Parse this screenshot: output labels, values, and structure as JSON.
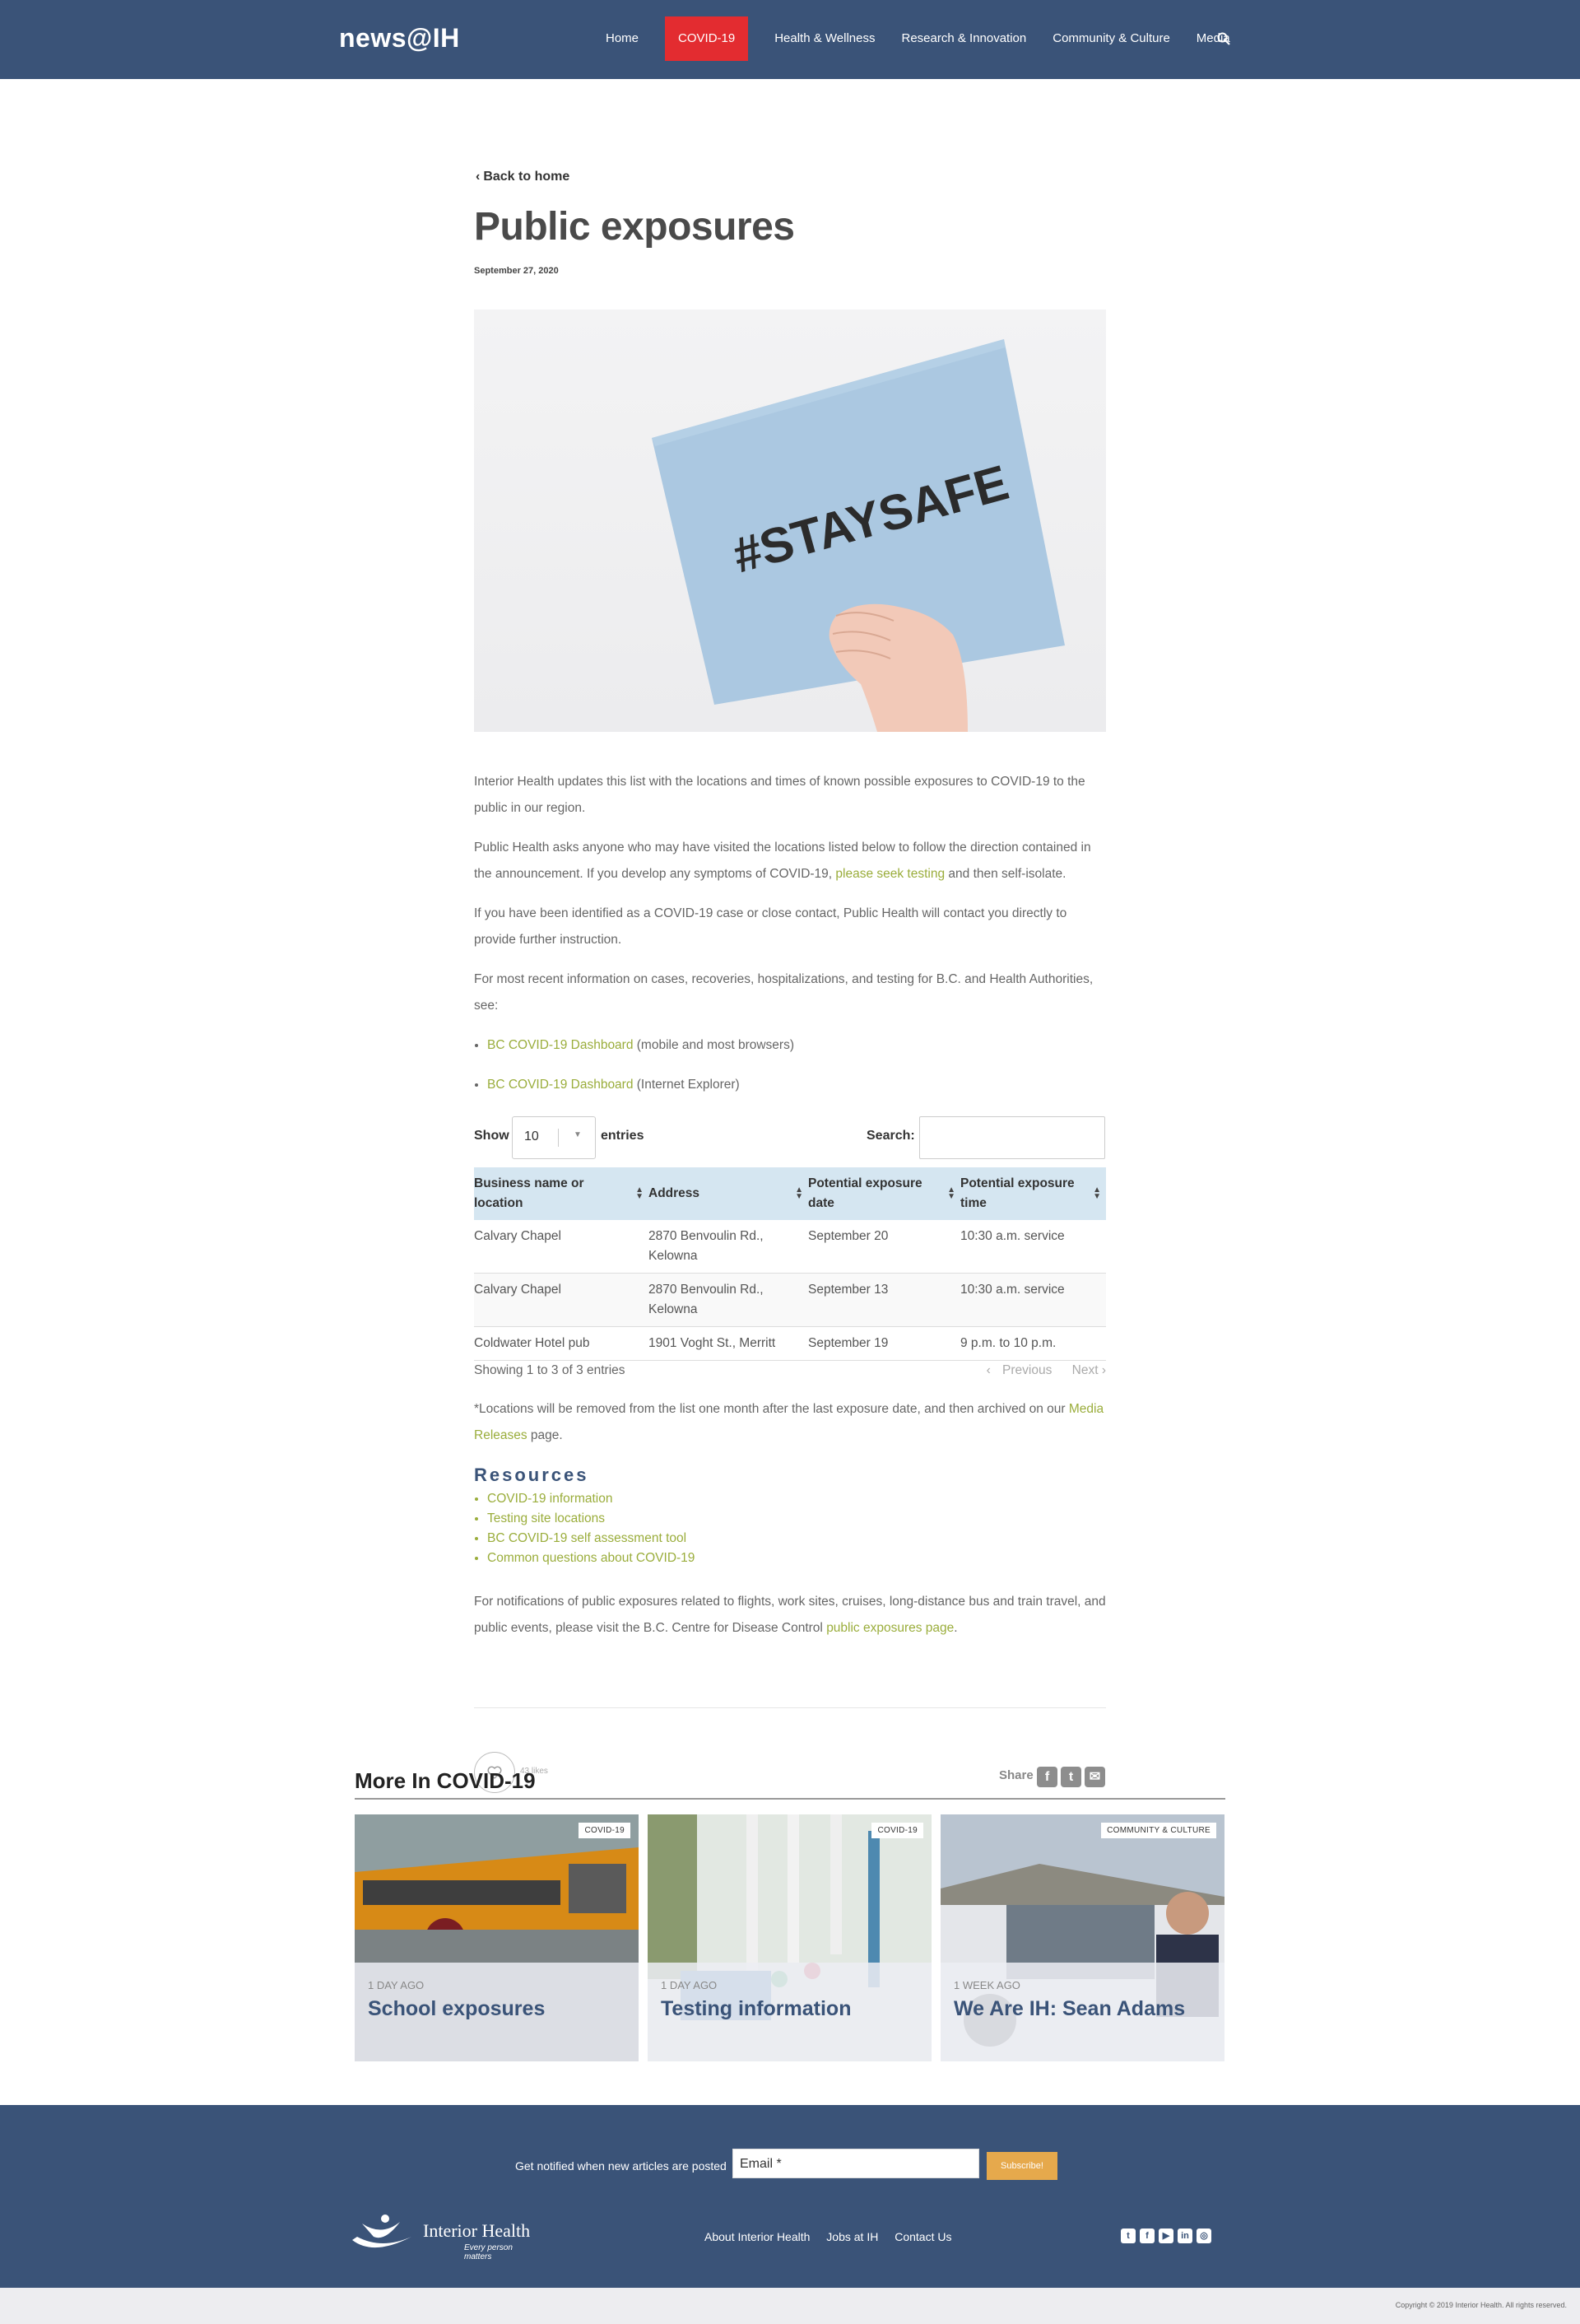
{
  "header": {
    "logo": "news@IH",
    "nav": [
      {
        "label": "Home",
        "active": false
      },
      {
        "label": "COVID-19",
        "active": true
      },
      {
        "label": "Health & Wellness",
        "active": false
      },
      {
        "label": "Research & Innovation",
        "active": false
      },
      {
        "label": "Community & Culture",
        "active": false
      },
      {
        "label": "Media",
        "active": false
      }
    ],
    "search_icon": "search-icon"
  },
  "article": {
    "back_label": "Back to home",
    "title": "Public exposures",
    "date": "September 27, 2020",
    "hero_text": "#STAYSAFE",
    "p1": "Interior Health updates this list with the locations and times of known possible exposures to COVID-19 to the public in our region.",
    "p2_before": "Public Health asks anyone who may have visited the locations listed below to follow the direction contained in the announcement. If you develop any symptoms of COVID-19, ",
    "p2_link": "please seek testing",
    "p2_after": " and then self-isolate.",
    "p3": "If you have been identified as a COVID-19 case or close contact, Public Health will contact you directly to provide further instruction.",
    "p4": "For most recent information on cases, recoveries, hospitalizations, and testing for B.C. and Health Authorities, see:",
    "dashboard_links": [
      {
        "link": "BC COVID-19 Dashboard",
        "suffix": " (mobile and most browsers)"
      },
      {
        "link": "BC COVID-19 Dashboard",
        "suffix": " (Internet Explorer)"
      }
    ]
  },
  "table": {
    "show_label": "Show",
    "page_size": "10",
    "entries_label": "entries",
    "search_label": "Search:",
    "columns": [
      "Business name or location",
      "Address",
      "Potential exposure date",
      "Potential exposure time"
    ],
    "rows": [
      {
        "name": "Calvary Chapel",
        "address": "2870 Benvoulin Rd., Kelowna",
        "date": "September 20",
        "time": "10:30 a.m. service"
      },
      {
        "name": "Calvary Chapel",
        "address": "2870 Benvoulin Rd., Kelowna",
        "date": "September 13",
        "time": "10:30 a.m. service"
      },
      {
        "name": "Coldwater Hotel pub",
        "address": "1901 Voght St., Merritt",
        "date": "September 19",
        "time": "9 p.m. to 10 p.m."
      }
    ],
    "info": "Showing 1 to 3 of 3 entries",
    "prev": "Previous",
    "next": "Next"
  },
  "note": {
    "before": "*Locations will be removed from the list one month after the last exposure date, and then archived on our ",
    "link": "Media Releases",
    "after": " page."
  },
  "resources": {
    "heading": "Resources",
    "items": [
      "COVID-19 information",
      "Testing site locations",
      "BC COVID-19 self assessment tool",
      "Common questions about COVID-19"
    ]
  },
  "notify_text": {
    "before": "For notifications of public exposures related to flights, work sites, cruises, long-distance bus and train travel, and public events, please visit the B.C. Centre for Disease Control ",
    "link": "public exposures page",
    "after": "."
  },
  "social": {
    "likes": "43 likes",
    "share_label": "Share",
    "share_icons": [
      "facebook-icon",
      "twitter-icon",
      "email-icon"
    ]
  },
  "more": {
    "heading": "More In COVID-19",
    "cards": [
      {
        "badge": "COVID-19",
        "ago": "1 DAY AGO",
        "title": "School exposures"
      },
      {
        "badge": "COVID-19",
        "ago": "1 DAY AGO",
        "title": "Testing information"
      },
      {
        "badge": "COMMUNITY & CULTURE",
        "ago": "1 WEEK AGO",
        "title": "We Are IH: Sean Adams"
      }
    ]
  },
  "footer": {
    "notify_label": "Get notified when new articles are posted",
    "email_placeholder": "Email *",
    "subscribe": "Subscribe!",
    "brand": "Interior Health",
    "tagline": "Every person matters",
    "links": [
      "About Interior Health",
      "Jobs at IH",
      "Contact Us"
    ],
    "social_icons": [
      "twitter-icon",
      "facebook-icon",
      "youtube-icon",
      "linkedin-icon",
      "instagram-icon"
    ],
    "copyright": "Copyright © 2019 Interior Health. All rights reserved."
  },
  "colors": {
    "header_bg": "#3a5378",
    "active_nav": "#e32c30",
    "link_green": "#9aad3b",
    "table_header": "#d5e6f1",
    "subscribe_btn": "#e6a94c"
  }
}
